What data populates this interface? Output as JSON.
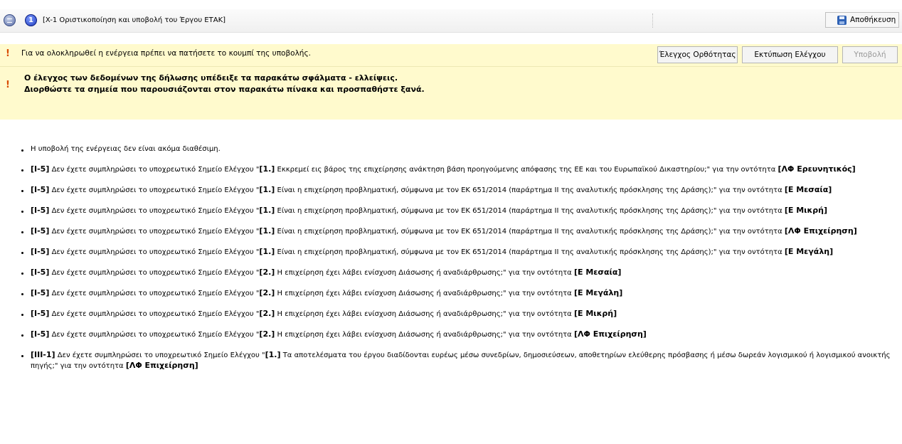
{
  "toolbar": {
    "title": "[X-1 Οριστικοποίηση και υποβολή του Έργου ΕΤΑΚ]",
    "step_number": "1",
    "save_label": "Αποθήκευση"
  },
  "notice": {
    "message": "Για να ολοκληρωθεί η ενέργεια πρέπει να πατήσετε το κουμπί της υποβολής.",
    "check_button": "Έλεγχος Ορθότητας",
    "print_button": "Εκτύπωση Ελέγχου",
    "submit_button": "Υποβολή"
  },
  "error": {
    "line1": "Ο έλεγχος των δεδομένων της δήλωσης υπέδειξε τα παρακάτω σφάλματα - ελλείψεις.",
    "line2": "Διορθώστε τα σημεία που παρουσιάζονται στον παρακάτω πίνακα και προσπαθήστε ξανά."
  },
  "items": [
    {
      "plain": "Η υποβολή της ενέργειας δεν είναι ακόμα διαθέσιμη."
    },
    {
      "code": "[I-5]",
      "pre": "Δεν έχετε συμπληρώσει το υποχρεωτικό Σημείο Ελέγχου \"",
      "num": "[1.]",
      "text": "Εκκρεμεί εις βάρος της επιχείρησης ανάκτηση βάση προηγούμενης απόφασης της ΕΕ και του Ευρωπαϊκού Δικαστηρίου;\" για την οντότητα",
      "entity": "[ΛΦ Ερευνητικός]"
    },
    {
      "code": "[I-5]",
      "pre": "Δεν έχετε συμπληρώσει το υποχρεωτικό Σημείο Ελέγχου \"",
      "num": "[1.]",
      "text": "Είναι η επιχείρηση προβληματική, σύμφωνα με τον ΕΚ 651/2014 (παράρτημα ΙΙ της αναλυτικής πρόσκλησης της Δράσης);\" για την οντότητα",
      "entity": "[Ε Μεσαία]"
    },
    {
      "code": "[I-5]",
      "pre": "Δεν έχετε συμπληρώσει το υποχρεωτικό Σημείο Ελέγχου \"",
      "num": "[1.]",
      "text": "Είναι η επιχείρηση προβληματική, σύμφωνα με τον ΕΚ 651/2014 (παράρτημα ΙΙ της αναλυτικής πρόσκλησης της Δράσης);\" για την οντότητα",
      "entity": "[Ε Μικρή]"
    },
    {
      "code": "[I-5]",
      "pre": "Δεν έχετε συμπληρώσει το υποχρεωτικό Σημείο Ελέγχου \"",
      "num": "[1.]",
      "text": "Είναι η επιχείρηση προβληματική, σύμφωνα με τον ΕΚ 651/2014 (παράρτημα ΙΙ της αναλυτικής πρόσκλησης της Δράσης);\" για την οντότητα",
      "entity": "[ΛΦ Επιχείρηση]"
    },
    {
      "code": "[I-5]",
      "pre": "Δεν έχετε συμπληρώσει το υποχρεωτικό Σημείο Ελέγχου \"",
      "num": "[1.]",
      "text": "Είναι η επιχείρηση προβληματική, σύμφωνα με τον ΕΚ 651/2014 (παράρτημα ΙΙ της αναλυτικής πρόσκλησης της Δράσης);\" για την οντότητα",
      "entity": "[Ε Μεγάλη]"
    },
    {
      "code": "[I-5]",
      "pre": "Δεν έχετε συμπληρώσει το υποχρεωτικό Σημείο Ελέγχου \"",
      "num": "[2.]",
      "text": "Η επιχείρηση έχει λάβει ενίσχυση Διάσωσης ή αναδιάρθρωσης;\" για την οντότητα",
      "entity": "[Ε Μεσαία]"
    },
    {
      "code": "[I-5]",
      "pre": "Δεν έχετε συμπληρώσει το υποχρεωτικό Σημείο Ελέγχου \"",
      "num": "[2.]",
      "text": "Η επιχείρηση έχει λάβει ενίσχυση Διάσωσης ή αναδιάρθρωσης;\" για την οντότητα",
      "entity": "[Ε Μεγάλη]"
    },
    {
      "code": "[I-5]",
      "pre": "Δεν έχετε συμπληρώσει το υποχρεωτικό Σημείο Ελέγχου \"",
      "num": "[2.]",
      "text": "Η επιχείρηση έχει λάβει ενίσχυση Διάσωσης ή αναδιάρθρωσης;\" για την οντότητα",
      "entity": "[Ε Μικρή]"
    },
    {
      "code": "[I-5]",
      "pre": "Δεν έχετε συμπληρώσει το υποχρεωτικό Σημείο Ελέγχου \"",
      "num": "[2.]",
      "text": "Η επιχείρηση έχει λάβει ενίσχυση Διάσωσης ή αναδιάρθρωσης;\" για την οντότητα",
      "entity": "[ΛΦ Επιχείρηση]"
    },
    {
      "code": "[III-1]",
      "pre": "Δεν έχετε συμπληρώσει το υποχρεωτικό Σημείο Ελέγχου \"",
      "num": "[1.]",
      "text": "Τα αποτελέσματα του έργου διαδίδονται ευρέως μέσω συνεδρίων, δημοσιεύσεων, αποθετηρίων ελεύθερης πρόσβασης ή μέσω δωρεάν λογισμικού ή λογισμικού ανοικτής πηγής;\" για την οντότητα",
      "entity": "[ΛΦ Επιχείρηση]"
    }
  ]
}
